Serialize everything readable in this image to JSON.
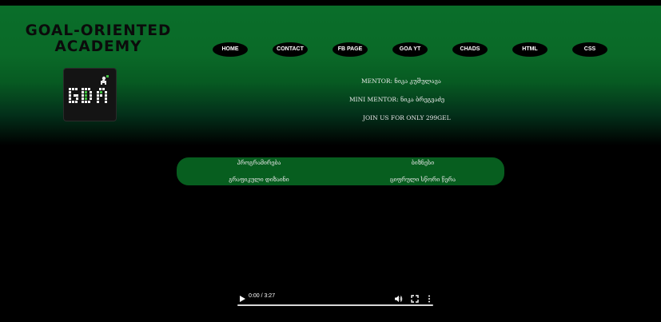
{
  "header": {
    "brand_line1": "GOAL-ORIENTED",
    "brand_line2": "ACADEMY"
  },
  "nav": {
    "items": [
      {
        "label": "HOME"
      },
      {
        "label": "CONTACT"
      },
      {
        "label": "FB PAGE"
      },
      {
        "label": "GOA YT"
      },
      {
        "label": "CHADS"
      },
      {
        "label": "HTML"
      },
      {
        "label": "CSS"
      }
    ]
  },
  "logo": {
    "icon": "goa-logo-icon",
    "text": "GOA"
  },
  "info": {
    "mentor": "MENTOR: ნიკა კუშულავა",
    "mini_mentor": "MINI MENTOR: ნიკა ბრეგვაძე",
    "join": "JOIN US FOR ONLY 299GEL"
  },
  "courses": [
    {
      "label": "პროგრამირება"
    },
    {
      "label": "ბიზნესი"
    },
    {
      "label": "გრაფიკული დიზაინი"
    },
    {
      "label": "ციფრული სწორი წერა"
    }
  ],
  "video": {
    "time": "0:00 / 3:27",
    "progress": 0
  },
  "colors": {
    "accent_green": "#0a6e2a",
    "course_bar": "#075e1f",
    "background": "#000000"
  }
}
